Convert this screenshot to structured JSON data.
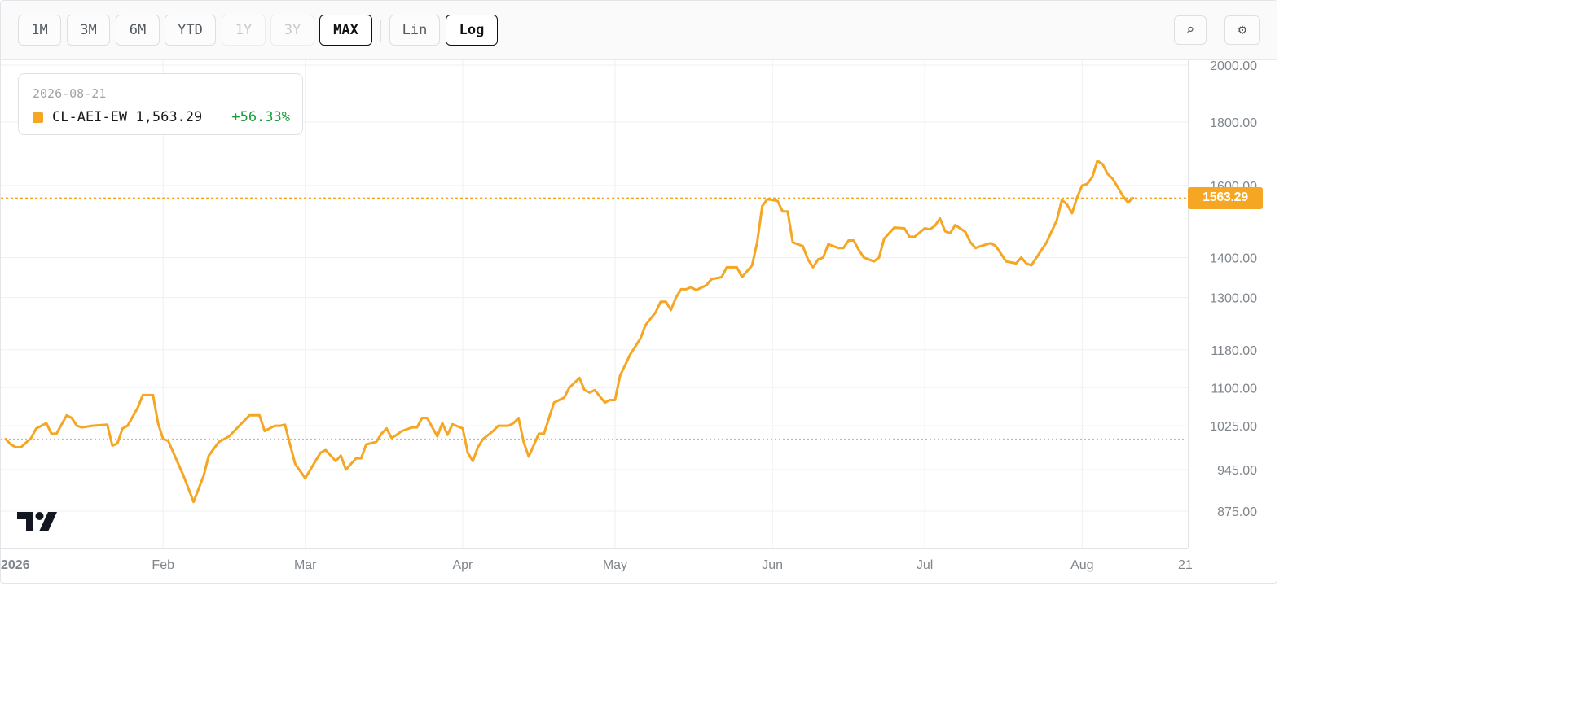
{
  "toolbar": {
    "ranges": [
      {
        "label": "1M",
        "state": "normal"
      },
      {
        "label": "3M",
        "state": "normal"
      },
      {
        "label": "6M",
        "state": "normal"
      },
      {
        "label": "YTD",
        "state": "normal"
      },
      {
        "label": "1Y",
        "state": "disabled"
      },
      {
        "label": "3Y",
        "state": "disabled"
      },
      {
        "label": "MAX",
        "state": "active"
      }
    ],
    "scales": [
      {
        "label": "Lin",
        "state": "normal"
      },
      {
        "label": "Log",
        "state": "active"
      }
    ],
    "search_icon": "⌕",
    "settings_icon": "⚙"
  },
  "legend": {
    "date": "2026-08-21",
    "symbol": "CL-AEI-EW",
    "value": "1,563.29",
    "change": "+56.33%"
  },
  "colors": {
    "line": "#f5a623",
    "positive": "#1a9e3c",
    "baseline": "#b8bcc0",
    "grid": "#eef0f2",
    "axis_text": "#7f858b"
  },
  "chart_data": {
    "type": "line",
    "scale": "log",
    "series": [
      {
        "name": "CL-AEI-EW",
        "last_value": 1563.29
      }
    ],
    "baseline": 1000,
    "ylim": [
      830,
      2000
    ],
    "y_ticks": [
      "875.00",
      "945.00",
      "1025.00",
      "1100.00",
      "1180.00",
      "1300.00",
      "1400.00",
      "1600.00",
      "1800.00",
      "2000.00"
    ],
    "x_ticks": [
      "2026",
      "Feb",
      "Mar",
      "Apr",
      "May",
      "Jun",
      "Jul",
      "Aug",
      "21"
    ],
    "x_range": [
      "2026-01-01",
      "2026-08-21"
    ],
    "x": [
      "2026-01-01",
      "2026-01-02",
      "2026-01-03",
      "2026-01-04",
      "2026-01-06",
      "2026-01-07",
      "2026-01-09",
      "2026-01-10",
      "2026-01-11",
      "2026-01-13",
      "2026-01-14",
      "2026-01-15",
      "2026-01-16",
      "2026-01-18",
      "2026-01-21",
      "2026-01-22",
      "2026-01-23",
      "2026-01-24",
      "2026-01-25",
      "2026-01-27",
      "2026-01-28",
      "2026-01-30",
      "2026-01-31",
      "2026-02-01",
      "2026-02-02",
      "2026-02-04",
      "2026-02-05",
      "2026-02-07",
      "2026-02-09",
      "2026-02-10",
      "2026-02-12",
      "2026-02-14",
      "2026-02-15",
      "2026-02-16",
      "2026-02-18",
      "2026-02-20",
      "2026-02-21",
      "2026-02-23",
      "2026-02-24",
      "2026-02-25",
      "2026-02-26",
      "2026-02-27",
      "2026-03-01",
      "2026-03-02",
      "2026-03-03",
      "2026-03-04",
      "2026-03-05",
      "2026-03-07",
      "2026-03-08",
      "2026-03-09",
      "2026-03-10",
      "2026-03-11",
      "2026-03-12",
      "2026-03-13",
      "2026-03-15",
      "2026-03-16",
      "2026-03-17",
      "2026-03-18",
      "2026-03-19",
      "2026-03-20",
      "2026-03-22",
      "2026-03-23",
      "2026-03-24",
      "2026-03-25",
      "2026-03-27",
      "2026-03-28",
      "2026-03-29",
      "2026-03-30",
      "2026-04-01",
      "2026-04-02",
      "2026-04-03",
      "2026-04-04",
      "2026-04-05",
      "2026-04-07",
      "2026-04-08",
      "2026-04-09",
      "2026-04-10",
      "2026-04-11",
      "2026-04-12",
      "2026-04-13",
      "2026-04-14",
      "2026-04-16",
      "2026-04-17",
      "2026-04-18",
      "2026-04-19",
      "2026-04-21",
      "2026-04-22",
      "2026-04-23",
      "2026-04-24",
      "2026-04-25",
      "2026-04-26",
      "2026-04-27",
      "2026-04-29",
      "2026-04-30",
      "2026-05-01",
      "2026-05-02",
      "2026-05-04",
      "2026-05-06",
      "2026-05-07",
      "2026-05-08",
      "2026-05-09",
      "2026-05-10",
      "2026-05-11",
      "2026-05-12",
      "2026-05-13",
      "2026-05-14",
      "2026-05-15",
      "2026-05-16",
      "2026-05-17",
      "2026-05-19",
      "2026-05-20",
      "2026-05-22",
      "2026-05-23",
      "2026-05-24",
      "2026-05-25",
      "2026-05-26",
      "2026-05-28",
      "2026-05-29",
      "2026-05-30",
      "2026-05-31",
      "2026-06-02",
      "2026-06-03",
      "2026-06-04",
      "2026-06-05",
      "2026-06-07",
      "2026-06-08",
      "2026-06-09",
      "2026-06-10",
      "2026-06-11",
      "2026-06-12",
      "2026-06-14",
      "2026-06-15",
      "2026-06-16",
      "2026-06-17",
      "2026-06-18",
      "2026-06-19",
      "2026-06-21",
      "2026-06-22",
      "2026-06-23",
      "2026-06-25",
      "2026-06-27",
      "2026-06-28",
      "2026-06-29",
      "2026-07-01",
      "2026-07-02",
      "2026-07-03",
      "2026-07-04",
      "2026-07-05",
      "2026-07-06",
      "2026-07-07",
      "2026-07-09",
      "2026-07-10",
      "2026-07-11",
      "2026-07-12",
      "2026-07-14",
      "2026-07-15",
      "2026-07-16",
      "2026-07-17",
      "2026-07-19",
      "2026-07-20",
      "2026-07-21",
      "2026-07-22",
      "2026-07-24",
      "2026-07-25",
      "2026-07-26",
      "2026-07-27",
      "2026-07-28",
      "2026-07-29",
      "2026-07-30",
      "2026-07-31",
      "2026-08-01",
      "2026-08-02",
      "2026-08-03",
      "2026-08-04",
      "2026-08-05",
      "2026-08-06",
      "2026-08-07",
      "2026-08-08",
      "2026-08-09",
      "2026-08-10",
      "2026-08-11",
      "2026-08-12",
      "2026-08-13",
      "2026-08-14",
      "2026-08-15",
      "2026-08-17",
      "2026-08-18",
      "2026-08-19",
      "2026-08-20",
      "2026-08-21"
    ],
    "y": [
      1000,
      990,
      985,
      985,
      1002,
      1020,
      1030,
      1010,
      1010,
      1045,
      1040,
      1025,
      1022,
      1025,
      1027,
      988,
      992,
      1020,
      1025,
      1060,
      1085,
      1085,
      1030,
      1000,
      997,
      955,
      935,
      890,
      935,
      970,
      995,
      1005,
      1015,
      1025,
      1045,
      1045,
      1015,
      1025,
      1025,
      1027,
      990,
      955,
      930,
      945,
      960,
      975,
      980,
      960,
      970,
      945,
      955,
      965,
      965,
      990,
      995,
      1010,
      1020,
      1002,
      1008,
      1015,
      1022,
      1022,
      1040,
      1040,
      1005,
      1030,
      1008,
      1028,
      1020,
      975,
      960,
      985,
      1000,
      1015,
      1025,
      1025,
      1025,
      1030,
      1040,
      995,
      968,
      1010,
      1010,
      1040,
      1070,
      1080,
      1100,
      1110,
      1120,
      1095,
      1090,
      1095,
      1070,
      1075,
      1075,
      1125,
      1170,
      1205,
      1235,
      1250,
      1265,
      1290,
      1290,
      1270,
      1300,
      1320,
      1320,
      1325,
      1318,
      1330,
      1345,
      1350,
      1375,
      1375,
      1375,
      1350,
      1380,
      1440,
      1540,
      1560,
      1555,
      1525,
      1525,
      1440,
      1430,
      1395,
      1375,
      1395,
      1400,
      1435,
      1425,
      1425,
      1445,
      1445,
      1420,
      1400,
      1390,
      1400,
      1450,
      1480,
      1478,
      1455,
      1455,
      1478,
      1475,
      1485,
      1505,
      1470,
      1465,
      1487,
      1468,
      1440,
      1425,
      1430,
      1438,
      1430,
      1410,
      1390,
      1385,
      1400,
      1385,
      1380,
      1420,
      1440,
      1470,
      1500,
      1558,
      1545,
      1520,
      1565,
      1600,
      1605,
      1625,
      1675,
      1665,
      1635,
      1620,
      1595,
      1570,
      1550,
      1563.29
    ]
  }
}
